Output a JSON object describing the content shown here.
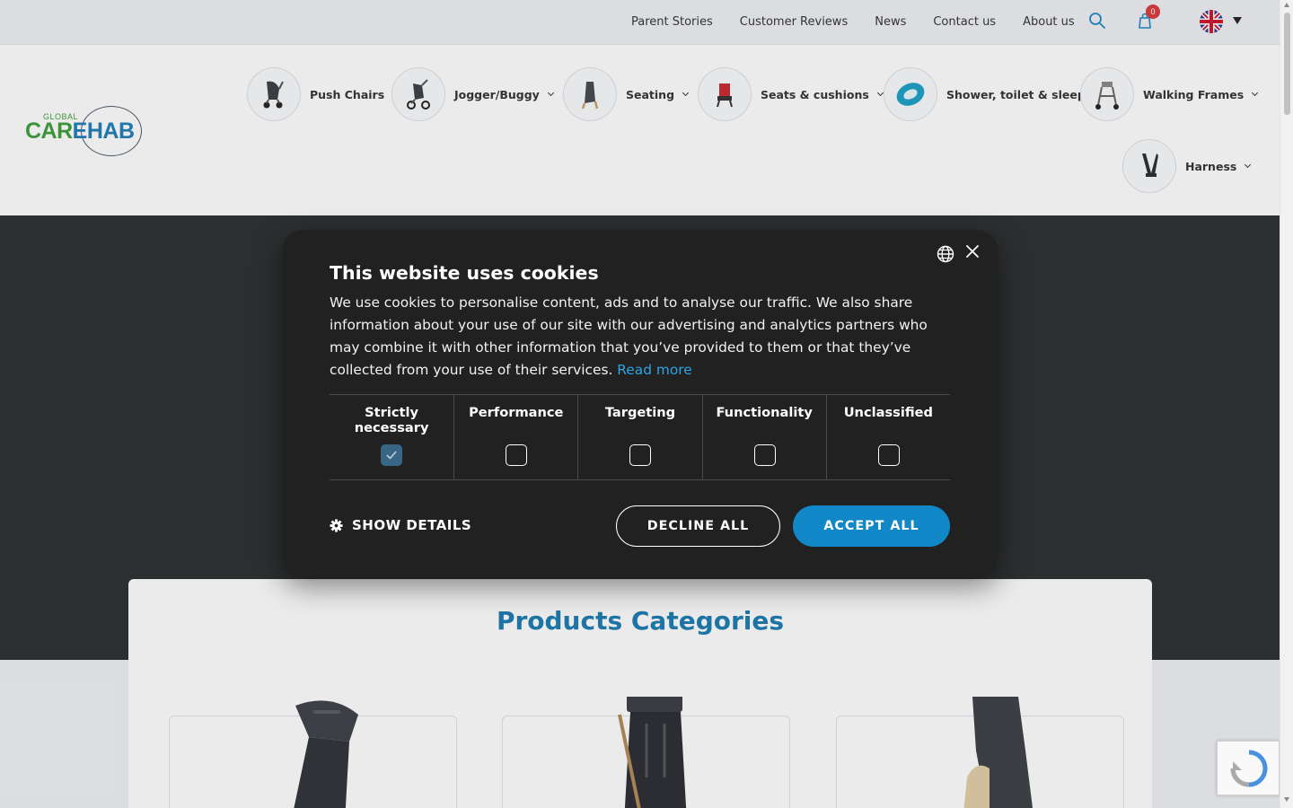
{
  "topbar": {
    "links": [
      "Parent Stories",
      "Customer Reviews",
      "News",
      "Contact us",
      "About us"
    ],
    "cart_count": "0",
    "language_flag": "uk-flag-icon"
  },
  "logo": {
    "small": "GLOBAL",
    "care": "CAR",
    "e": "E",
    "hab": "HAB"
  },
  "nav": {
    "items": [
      {
        "label": "Push Chairs",
        "icon": "push-chair-icon"
      },
      {
        "label": "Jogger/Buggy",
        "icon": "jogger-buggy-icon"
      },
      {
        "label": "Seating",
        "icon": "seating-icon"
      },
      {
        "label": "Seats & cushions",
        "icon": "seat-cushion-icon"
      },
      {
        "label": "Shower, toilet & sleep",
        "icon": "shower-toilet-icon"
      },
      {
        "label": "Walking Frames",
        "icon": "walking-frame-icon"
      },
      {
        "label": "Harness",
        "icon": "harness-icon"
      }
    ]
  },
  "products": {
    "title": "Products Categories"
  },
  "cookie": {
    "title": "This website uses cookies",
    "body": "We use cookies to personalise content, ads and to analyse our traffic. We also share information about your use of our site with our advertising and analytics partners who may combine it with other information that you’ve provided to them or that they’ve collected from your use of their services.",
    "read_more": "Read more",
    "categories": [
      {
        "label": "Strictly necessary",
        "checked": true
      },
      {
        "label": "Performance",
        "checked": false
      },
      {
        "label": "Targeting",
        "checked": false
      },
      {
        "label": "Functionality",
        "checked": false
      },
      {
        "label": "Unclassified",
        "checked": false
      }
    ],
    "show_details": "SHOW DETAILS",
    "decline": "DECLINE ALL",
    "accept": "ACCEPT ALL"
  },
  "colors": {
    "accent": "#1187c8",
    "title_blue": "#1a7bb1",
    "modal_bg": "#212121",
    "hero_bg": "#2b2e2f"
  }
}
